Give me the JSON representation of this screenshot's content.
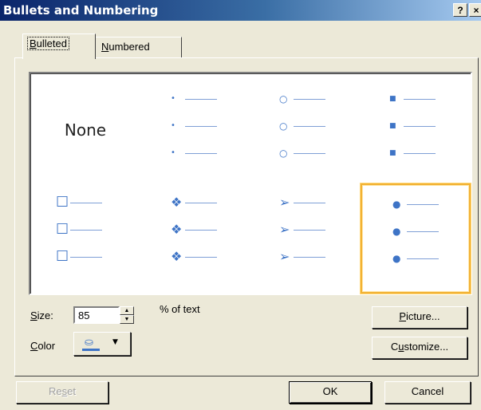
{
  "window": {
    "title": "Bullets and Numbering",
    "help_label": "?",
    "close_label": "×"
  },
  "tabs": [
    {
      "label": "Bulleted",
      "mnemonic": "B",
      "rest": "ulleted",
      "active": true
    },
    {
      "label": "Numbered",
      "mnemonic": "N",
      "rest": "umbered",
      "active": false
    }
  ],
  "gallery": {
    "none_label": "None",
    "selected_index": 7,
    "bullet_color": "#3e74c6",
    "selection_color": "#f2b134",
    "styles": [
      {
        "name": "none",
        "glyph": ""
      },
      {
        "name": "small-dot",
        "glyph": "•"
      },
      {
        "name": "hollow-circle",
        "glyph": "○"
      },
      {
        "name": "small-square",
        "glyph": "■"
      },
      {
        "name": "hollow-square",
        "glyph": "☐"
      },
      {
        "name": "four-diamond",
        "glyph": "❖"
      },
      {
        "name": "arrowhead",
        "glyph": "➢"
      },
      {
        "name": "large-dot",
        "glyph": "●"
      }
    ]
  },
  "size": {
    "label_mnemonic": "S",
    "label_rest": "ize:",
    "value": "85",
    "suffix": "% of text"
  },
  "color": {
    "label_mnemonic": "C",
    "label_rest": "olor",
    "value": "#3e74c6",
    "icon": "paint-bucket-icon"
  },
  "buttons": {
    "picture": {
      "mnemonic": "P",
      "rest": "icture..."
    },
    "customize": {
      "pre": "C",
      "mnemonic": "u",
      "rest": "stomize..."
    },
    "reset": {
      "pre": "Re",
      "mnemonic": "s",
      "rest": "et",
      "disabled": true
    },
    "ok": "OK",
    "cancel": "Cancel"
  }
}
